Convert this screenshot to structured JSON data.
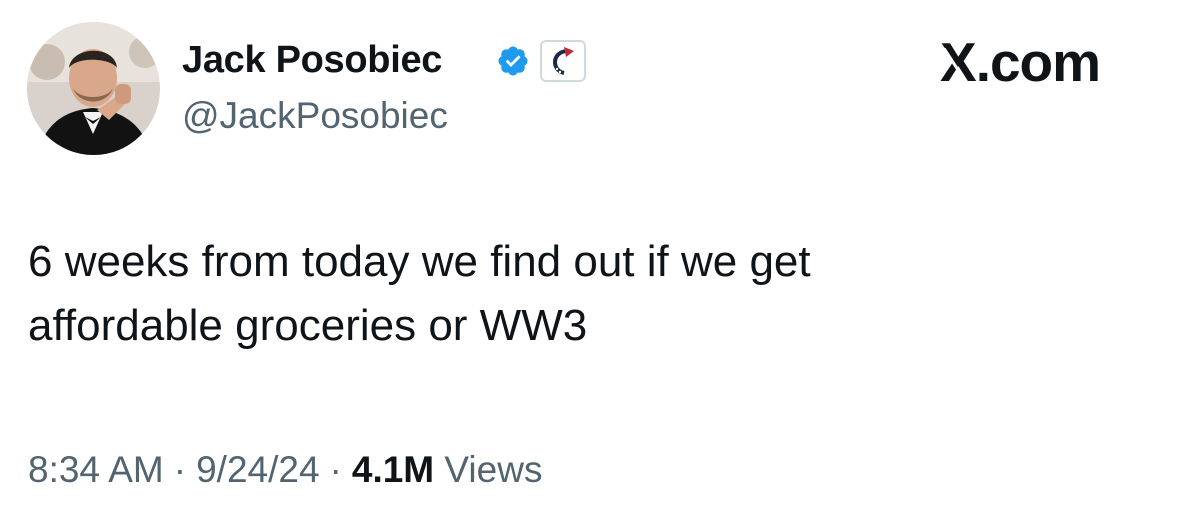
{
  "author": {
    "display_name": "Jack Posobiec",
    "handle": "@JackPosobiec",
    "verified": true,
    "verified_color": "#1d9bf0"
  },
  "site": {
    "logo_letter": "X",
    "domain": ".com"
  },
  "tweet": {
    "text_lines": [
      "6 weeks from today we find out if we get",
      "affordable groceries or WW3"
    ]
  },
  "meta": {
    "time": "8:34 AM",
    "separator": "·",
    "date": "9/24/24",
    "views_count": "4.1M",
    "views_label": "Views"
  }
}
